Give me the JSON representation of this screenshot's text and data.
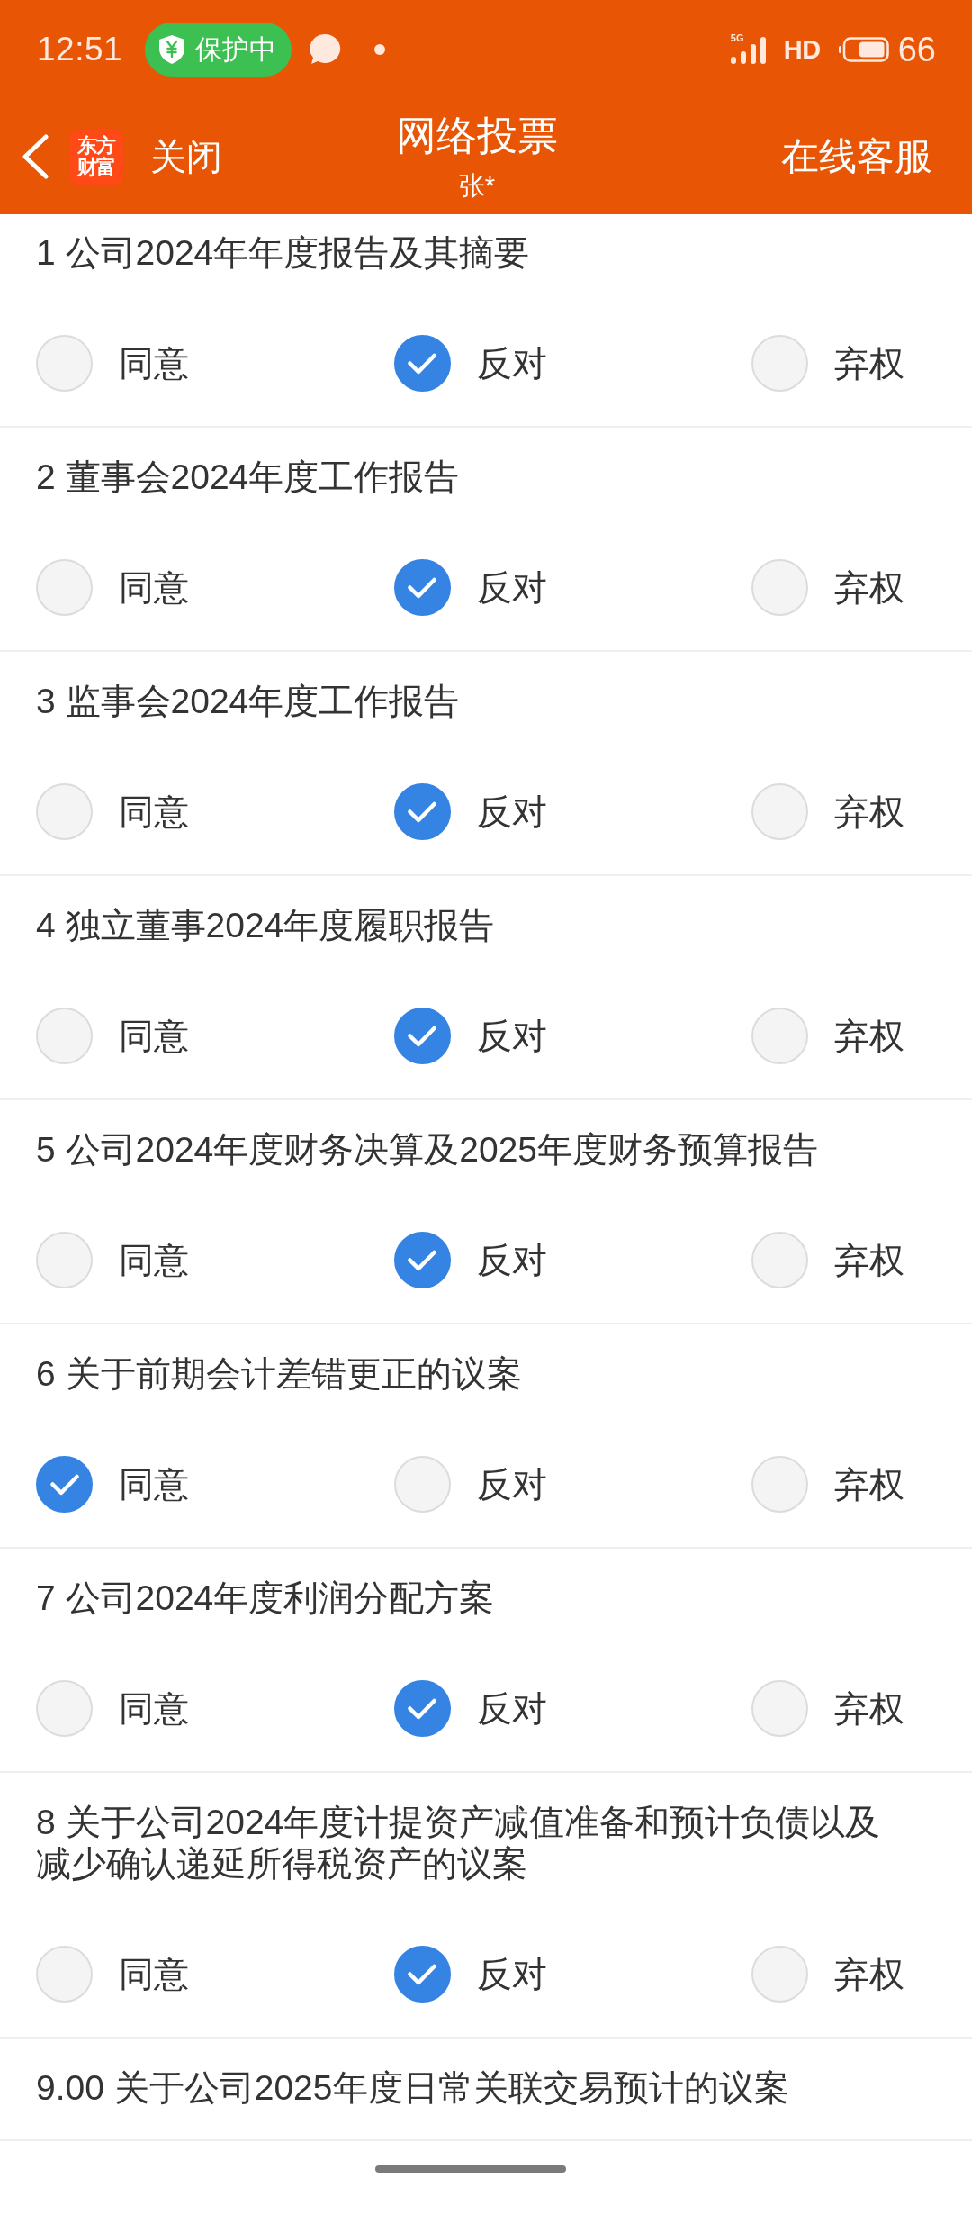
{
  "status_bar": {
    "time": "12:51",
    "protection": "保护中",
    "network": "5G",
    "hd": "HD",
    "battery": "66"
  },
  "nav": {
    "close": "关闭",
    "logo": [
      "东方",
      "财富"
    ],
    "title": "网络投票",
    "subtitle": "张*",
    "service": "在线客服"
  },
  "proposals": [
    {
      "kind": "vote",
      "title": "1 公司2024年年度报告及其摘要",
      "options": [
        {
          "label": "同意",
          "selected": false
        },
        {
          "label": "反对",
          "selected": true
        },
        {
          "label": "弃权",
          "selected": false
        }
      ]
    },
    {
      "kind": "vote",
      "title": "2 董事会2024年度工作报告",
      "options": [
        {
          "label": "同意",
          "selected": false
        },
        {
          "label": "反对",
          "selected": true
        },
        {
          "label": "弃权",
          "selected": false
        }
      ]
    },
    {
      "kind": "vote",
      "title": "3 监事会2024年度工作报告",
      "options": [
        {
          "label": "同意",
          "selected": false
        },
        {
          "label": "反对",
          "selected": true
        },
        {
          "label": "弃权",
          "selected": false
        }
      ]
    },
    {
      "kind": "vote",
      "title": "4 独立董事2024年度履职报告",
      "options": [
        {
          "label": "同意",
          "selected": false
        },
        {
          "label": "反对",
          "selected": true
        },
        {
          "label": "弃权",
          "selected": false
        }
      ]
    },
    {
      "kind": "vote",
      "title": "5 公司2024年度财务决算及2025年度财务预算报告",
      "options": [
        {
          "label": "同意",
          "selected": false
        },
        {
          "label": "反对",
          "selected": true
        },
        {
          "label": "弃权",
          "selected": false
        }
      ]
    },
    {
      "kind": "vote",
      "title": "6 关于前期会计差错更正的议案",
      "options": [
        {
          "label": "同意",
          "selected": true
        },
        {
          "label": "反对",
          "selected": false
        },
        {
          "label": "弃权",
          "selected": false
        }
      ]
    },
    {
      "kind": "vote",
      "title": "7 公司2024年度利润分配方案",
      "options": [
        {
          "label": "同意",
          "selected": false
        },
        {
          "label": "反对",
          "selected": true
        },
        {
          "label": "弃权",
          "selected": false
        }
      ]
    },
    {
      "kind": "vote",
      "title": "8 关于公司2024年度计提资产减值准备和预计负债以及减少确认递延所得税资产的议案",
      "options": [
        {
          "label": "同意",
          "selected": false
        },
        {
          "label": "反对",
          "selected": true
        },
        {
          "label": "弃权",
          "selected": false
        }
      ]
    },
    {
      "kind": "group",
      "title": "9.00 关于公司2025年度日常关联交易预计的议案"
    }
  ]
}
